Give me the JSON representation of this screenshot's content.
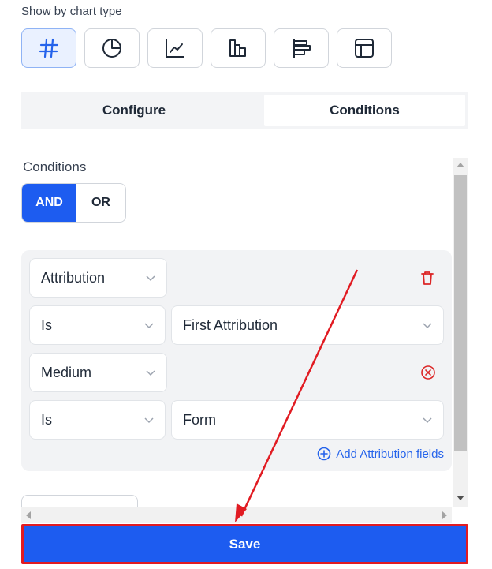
{
  "header": {
    "show_by_label": "Show by chart type"
  },
  "chart_types": {
    "buttons": [
      {
        "icon": "hash-icon",
        "active": true
      },
      {
        "icon": "pie-chart-icon",
        "active": false
      },
      {
        "icon": "line-chart-icon",
        "active": false
      },
      {
        "icon": "bar-chart-icon",
        "active": false
      },
      {
        "icon": "horizontal-bar-chart-icon",
        "active": false
      },
      {
        "icon": "table-icon",
        "active": false
      }
    ],
    "active_color": "#2563eb"
  },
  "tabs": [
    {
      "label": "Configure",
      "selected": false
    },
    {
      "label": "Conditions",
      "selected": true
    }
  ],
  "conditions": {
    "label": "Conditions",
    "logic_options": [
      "AND",
      "OR"
    ],
    "logic_selected": "AND",
    "group": {
      "rows": [
        {
          "field": "Attribution",
          "delete_icon": "trash-icon"
        },
        {
          "operator": "Is",
          "value": "First Attribution"
        },
        {
          "field": "Medium",
          "remove_icon": "x-circle-icon"
        },
        {
          "operator": "Is",
          "value": "Form"
        }
      ],
      "add_link": "Add Attribution fields",
      "add_icon": "plus-circle-icon"
    }
  },
  "footer": {
    "save_label": "Save"
  },
  "colors": {
    "primary": "#1d5cf0",
    "danger": "#dc2626",
    "annotation": "#e11b22"
  }
}
